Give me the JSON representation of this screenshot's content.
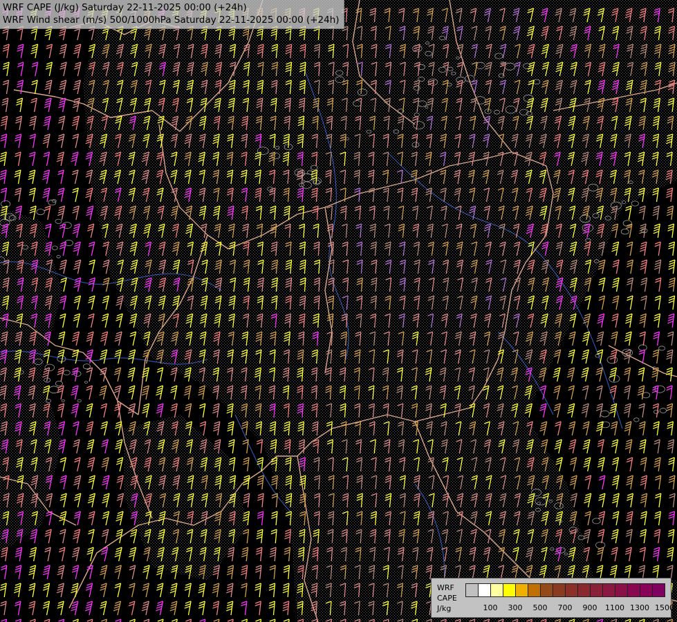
{
  "title_lines": [
    "WRF CAPE (J/kg) Saturday 22-11-2025 00:00 (+24h)",
    "WRF Wind shear (m/s) 500/1000hPa Saturday 22-11-2025 00:00 (+24h)"
  ],
  "legend": {
    "label_lines": [
      "WRF",
      "CAPE",
      "J/kg"
    ],
    "colors": [
      "#c0c0c0",
      "#ffffff",
      "#ffffa0",
      "#ffff00",
      "#f0b000",
      "#c07000",
      "#944a18",
      "#8a3a20",
      "#8a3028",
      "#8a2830",
      "#8a2038",
      "#8a1840",
      "#8a1048",
      "#8a0850",
      "#880058",
      "#800060"
    ],
    "ticks": [
      "100",
      "300",
      "500",
      "700",
      "900",
      "1100",
      "1300",
      "1500"
    ]
  },
  "palette": {
    "background": "#000000",
    "barb_colors": [
      "#ff33ff",
      "#f77f7f",
      "#ffff33",
      "#d4a04a",
      "#e18a8a",
      "#b56fd9",
      "#ba8a7a"
    ],
    "border_color": "#e8b090",
    "coast_color": "#3a5fd0",
    "river_color": "#3a6ad8",
    "contour_color": "#9a9a9a"
  }
}
